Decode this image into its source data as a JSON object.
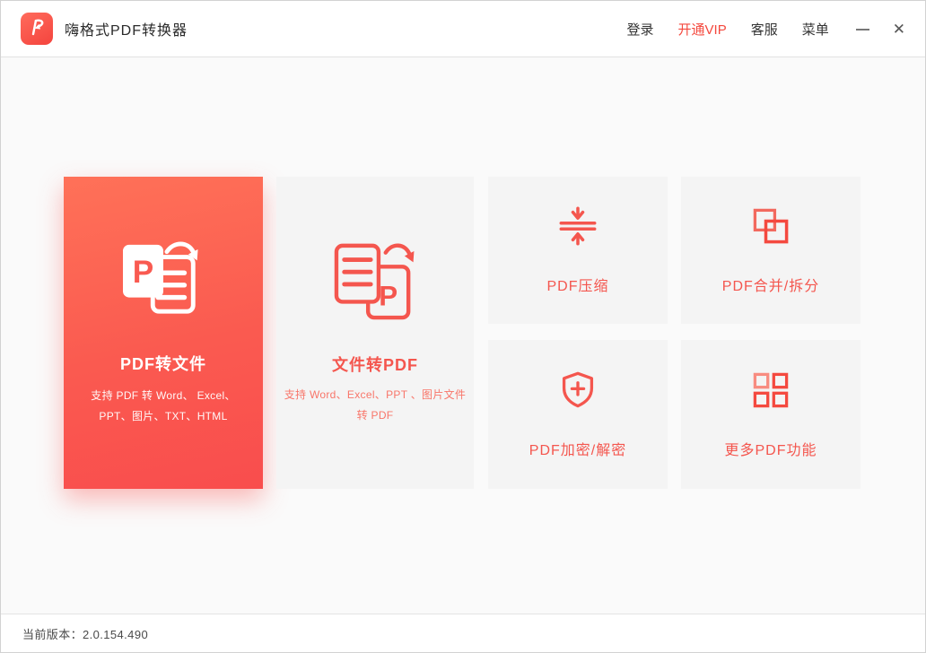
{
  "app": {
    "title": "嗨格式PDF转换器",
    "logo_icon": "pdf-brand-icon",
    "accent_color": "#f4564e"
  },
  "topbar": {
    "login_label": "登录",
    "vip_label": "开通VIP",
    "vip_color": "#f4483d",
    "support_label": "客服",
    "menu_label": "菜单",
    "minimize_icon": "minimize-icon",
    "close_icon": "close-icon",
    "close_glyph": "✕"
  },
  "cards": {
    "pdf_to_file": {
      "title": "PDF转文件",
      "subtitle": "支持 PDF 转 Word、 Excel、PPT、图片、TXT、HTML",
      "icon": "pdf-to-file-icon",
      "gradient_top": "#ff7158",
      "gradient_bottom": "#f94d4d"
    },
    "file_to_pdf": {
      "title": "文件转PDF",
      "subtitle": "支持 Word、Excel、PPT 、图片文件转 PDF",
      "icon": "file-to-pdf-icon"
    },
    "compress": {
      "title": "PDF压缩",
      "icon": "compress-icon"
    },
    "merge_split": {
      "title": "PDF合并/拆分",
      "icon": "merge-split-icon"
    },
    "encrypt_decrypt": {
      "title": "PDF加密/解密",
      "icon": "shield-plus-icon"
    },
    "more": {
      "title": "更多PDF功能",
      "icon": "grid-icon"
    }
  },
  "statusbar": {
    "version_label": "当前版本：2.0.154.490"
  }
}
